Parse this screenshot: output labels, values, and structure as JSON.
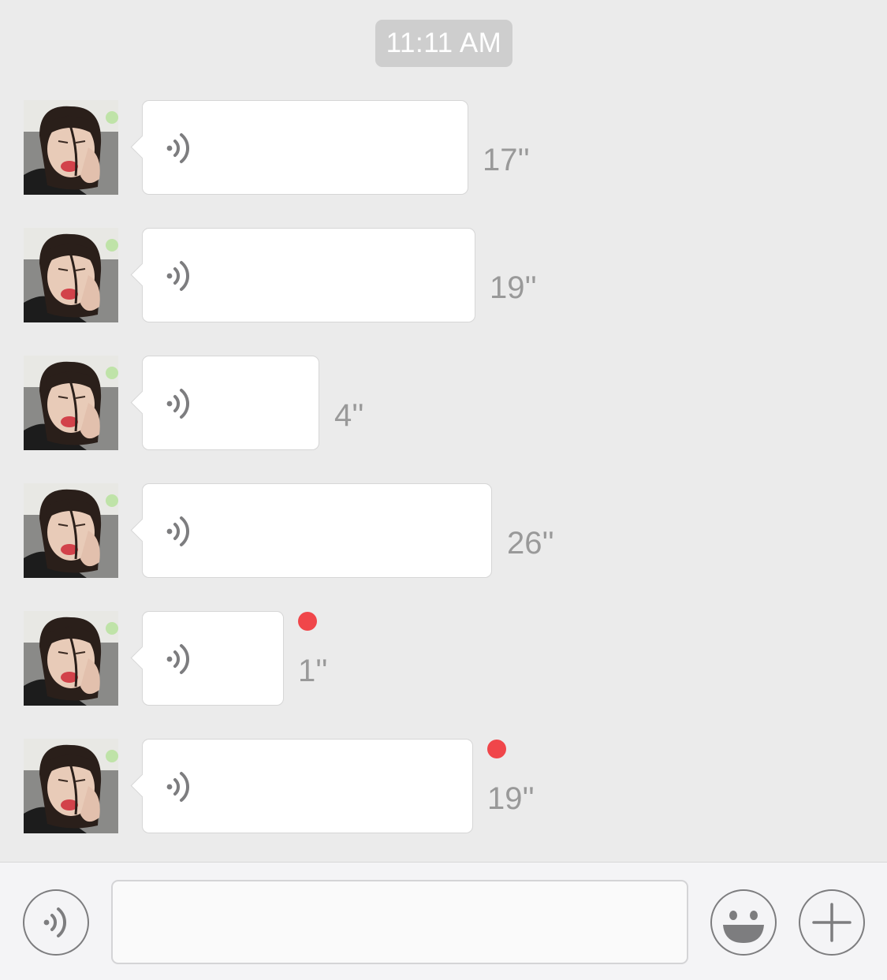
{
  "chat": {
    "timestamp": "11:11 AM",
    "messages": [
      {
        "type": "voice",
        "duration": "17''",
        "unread": false
      },
      {
        "type": "voice",
        "duration": "19''",
        "unread": false
      },
      {
        "type": "voice",
        "duration": "4''",
        "unread": false
      },
      {
        "type": "voice",
        "duration": "26''",
        "unread": false
      },
      {
        "type": "voice",
        "duration": "1''",
        "unread": true
      },
      {
        "type": "voice",
        "duration": "19''",
        "unread": true
      }
    ]
  },
  "input_bar": {
    "text_value": "",
    "left_icon": "voice-mode-icon",
    "right_icons": [
      "emoji-icon",
      "plus-icon"
    ]
  },
  "colors": {
    "background": "#ebebeb",
    "bubble": "#ffffff",
    "unread_dot": "#f0464a",
    "icon_gray": "#7d7d7f"
  }
}
